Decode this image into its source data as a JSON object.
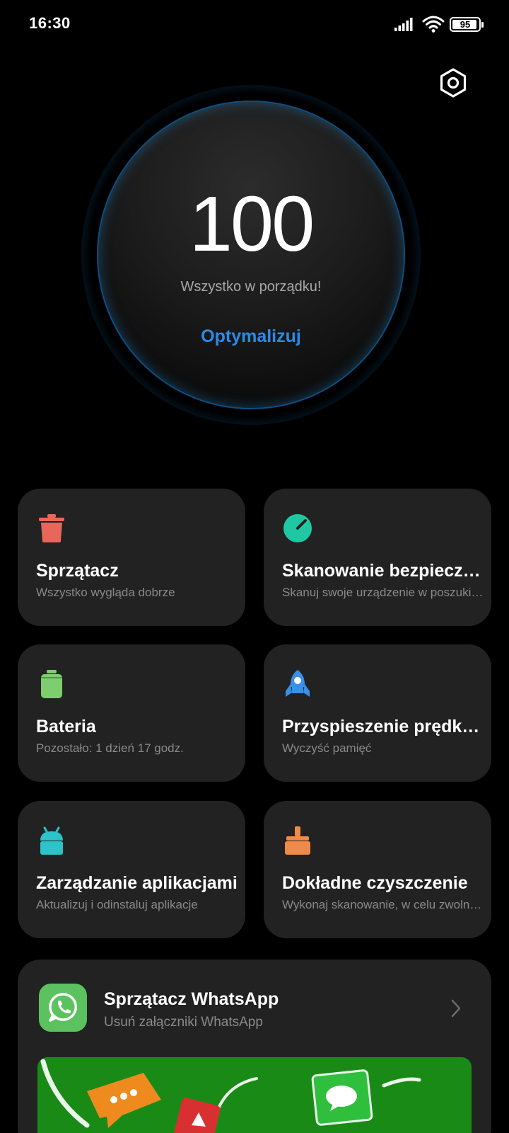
{
  "status_bar": {
    "time": "16:30",
    "battery_level": "95",
    "battery_fraction": 0.95,
    "icons": [
      "signal-icon",
      "wifi-icon",
      "battery-icon"
    ]
  },
  "header": {
    "settings_icon": "settings-hexagon-icon"
  },
  "score": {
    "value": "100",
    "status": "Wszystko w porządku!",
    "action_label": "Optymalizuj",
    "accent_color": "#1ea8ee",
    "action_color": "#2b8ae8"
  },
  "tiles": [
    {
      "title": "Sprzątacz",
      "subtitle": "Wszystko wygląda dobrze",
      "icon": "trash-bin-icon",
      "color": "#e8675a"
    },
    {
      "title": "Skanowanie bezpieczeństwa",
      "subtitle": "Skanuj swoje urządzenie w poszukiwaniu zagrożeń",
      "icon": "security-gauge-icon",
      "color": "#1fc8a3"
    },
    {
      "title": "Bateria",
      "subtitle": "Pozostało: 1 dzień 17 godz.",
      "icon": "battery-tile-icon",
      "color": "#7dce6e"
    },
    {
      "title": "Przyspieszenie prędkości",
      "subtitle": "Wyczyść pamięć",
      "icon": "rocket-icon",
      "color": "#3a8fe8"
    },
    {
      "title": "Zarządzanie aplikacjami",
      "subtitle": "Aktualizuj i odinstaluj aplikacje",
      "icon": "android-icon",
      "color": "#2cc3c9"
    },
    {
      "title": "Dokładne czyszczenie",
      "subtitle": "Wykonaj skanowanie, w celu zwolnienia miejsca",
      "icon": "broom-icon",
      "color": "#ee8a4a"
    }
  ],
  "whatsapp_card": {
    "title": "Sprzątacz WhatsApp",
    "subtitle": "Usuń załączniki WhatsApp",
    "icon": "whatsapp-icon",
    "chevron_icon": "chevron-right-icon",
    "banner_color": "#1a8a17"
  }
}
